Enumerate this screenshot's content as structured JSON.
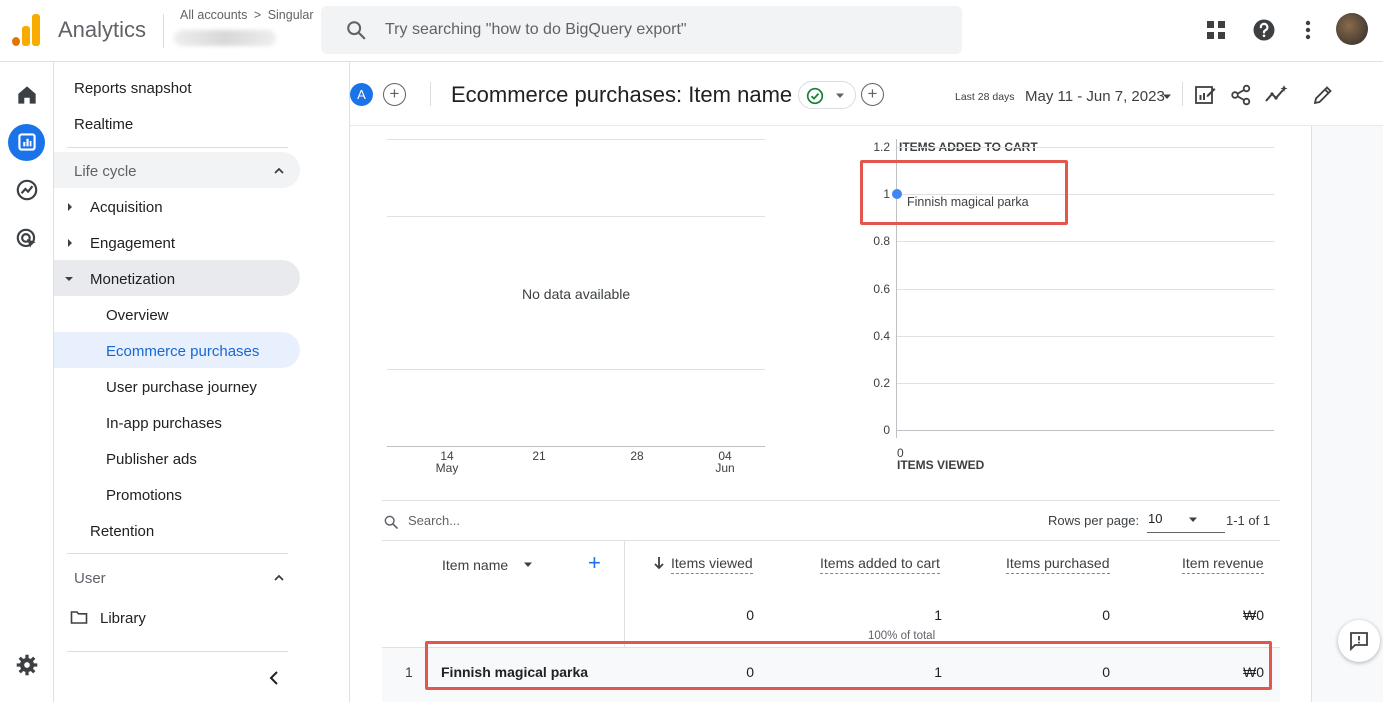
{
  "header": {
    "app_title": "Analytics",
    "breadcrumb_all": "All accounts",
    "breadcrumb_sep": ">",
    "breadcrumb_account": "Singular",
    "search_placeholder": "Try searching \"how to do BigQuery export\""
  },
  "nav": {
    "reports_snapshot": "Reports snapshot",
    "realtime": "Realtime",
    "lifecycle": "Life cycle",
    "acquisition": "Acquisition",
    "engagement": "Engagement",
    "monetization": "Monetization",
    "overview": "Overview",
    "ecommerce": "Ecommerce purchases",
    "user_journey": "User purchase journey",
    "inapp": "In-app purchases",
    "publisher_ads": "Publisher ads",
    "promotions": "Promotions",
    "retention": "Retention",
    "user": "User",
    "library": "Library"
  },
  "report": {
    "badge": "A",
    "title": "Ecommerce purchases: Item name",
    "date_label": "Last 28 days",
    "date_range": "May 11 - Jun 7, 2023"
  },
  "chart_data": [
    {
      "type": "line",
      "no_data_text": "No data available",
      "x_ticks": [
        {
          "day": "14",
          "month": "May"
        },
        {
          "day": "21",
          "month": ""
        },
        {
          "day": "28",
          "month": ""
        },
        {
          "day": "04",
          "month": "Jun"
        }
      ],
      "grid": true
    },
    {
      "type": "scatter",
      "ylabel": "ITEMS ADDED TO CART",
      "xlabel": "ITEMS VIEWED",
      "y_ticks": [
        "1.2",
        "1",
        "0.8",
        "0.6",
        "0.4",
        "0.2",
        "0"
      ],
      "x_ticks": [
        "0"
      ],
      "ylim": [
        0,
        1.2
      ],
      "points": [
        {
          "x": 0,
          "y": 1,
          "label": "Finnish magical parka"
        }
      ],
      "point_color": "#4285f4",
      "grid": true
    }
  ],
  "table": {
    "search_placeholder": "Search...",
    "rows_per_page_label": "Rows per page:",
    "rows_per_page": "10",
    "pagination": "1-1 of 1",
    "dim_header": "Item name",
    "columns": [
      "Items viewed",
      "Items added to cart",
      "Items purchased",
      "Item revenue"
    ],
    "totals": [
      "0",
      "1",
      "0",
      "₩0"
    ],
    "totals_note": "100% of total",
    "rows": [
      {
        "index": "1",
        "name": "Finnish magical parka",
        "values": [
          "0",
          "1",
          "0",
          "₩0"
        ]
      }
    ]
  },
  "colors": {
    "accent": "#1a73e8",
    "highlight": "#e2574c",
    "active_nav_bg": "#e8f0fe"
  }
}
